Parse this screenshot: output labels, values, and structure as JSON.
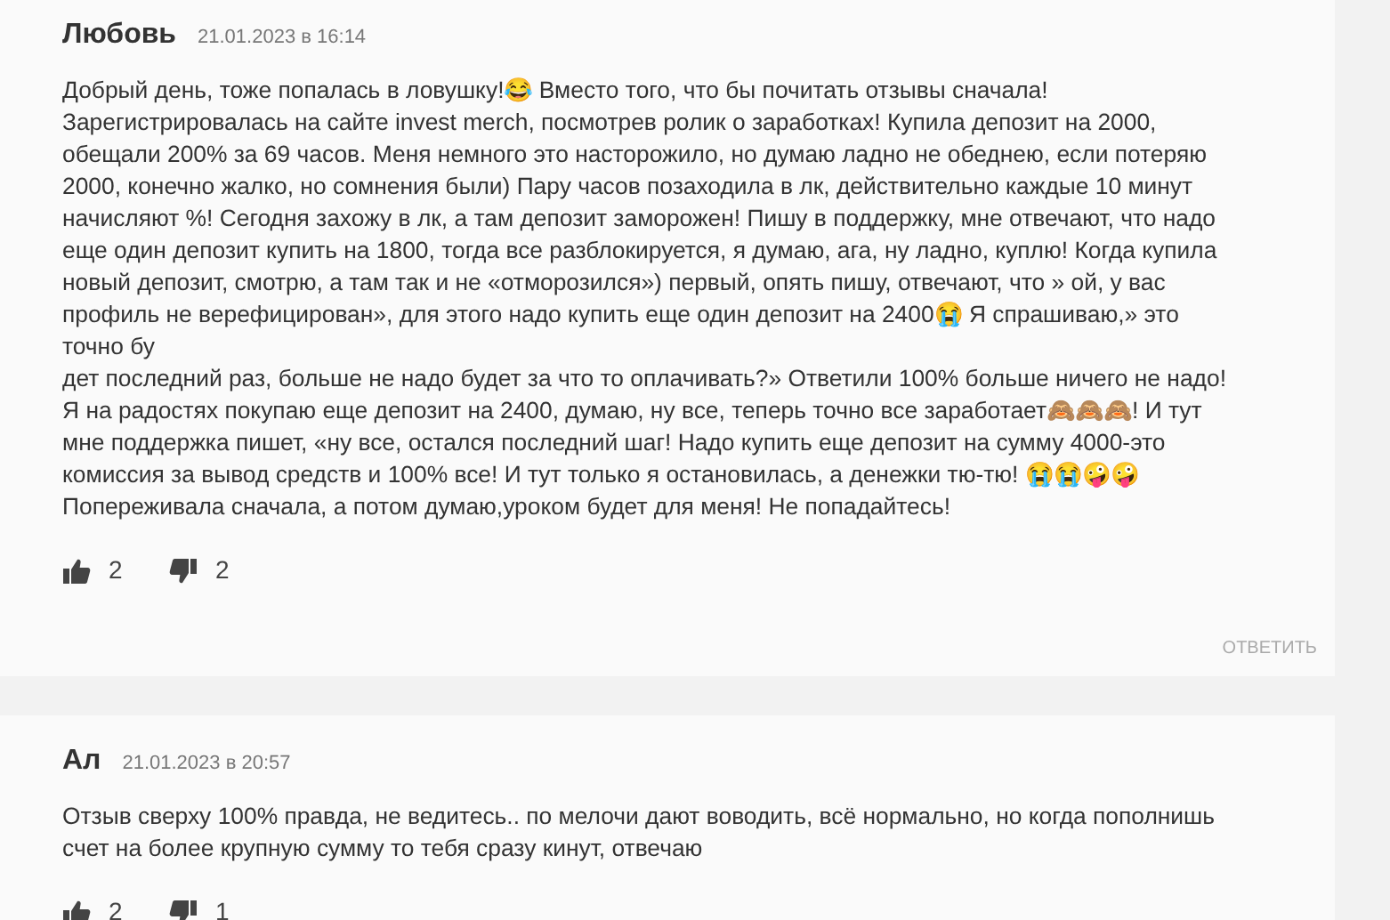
{
  "comments": [
    {
      "author": "Любовь",
      "date": "21.01.2023 в 16:14",
      "paragraphs": [
        "Добрый день, тоже попалась в ловушку!😂 Вместо того, что бы почитать отзывы сначала! Зарегистрировалась на сайте invest merch, посмотрев ролик о заработках! Купила депозит на 2000, обещали 200% за 69 часов. Меня немного это насторожило, но думаю ладно не обеднею, если потеряю 2000, конечно жалко, но сомнения были) Пару часов позаходила в лк, действительно каждые 10 минут начисляют %! Сегодня захожу в лк, а там депозит заморожен! Пишу в поддержку, мне отвечают, что надо еще один депозит купить на 1800, тогда все разблокируется, я думаю, ага, ну ладно, куплю! Когда купила новый депозит, смотрю, а там так и не «отморозился») первый, опять пишу, отвечают, что » ой, у вас профиль не верефицирован», для этого надо купить еще один депозит на 2400😭 Я спрашиваю,» это точно бу",
        "дет последний раз, больше не надо будет за что то оплачивать?» Ответили 100% больше ничего не надо! Я на радостях покупаю еще депозит на 2400, думаю, ну все, теперь точно все заработает🙈🙈🙈! И тут мне поддержка пишет, «ну все, остался последний шаг! Надо купить еще депозит на сумму 4000-это комиссия за вывод средств и 100% все! И тут только я остановилась, а денежки тю-тю! 😭😭🤪🤪 Попереживала сначала, а потом думаю,уроком будет для меня! Не попадайтесь!"
      ],
      "likes": "2",
      "dislikes": "2",
      "reply": "ОТВЕТИТЬ"
    },
    {
      "author": "Ал",
      "date": "21.01.2023 в 20:57",
      "paragraphs": [
        "Отзыв сверху 100% правда, не ведитесь.. по мелочи дают воводить, всё нормально, но когда пополнишь счет на более крупную сумму то тебя сразу кинут, отвечаю"
      ],
      "likes": "2",
      "dislikes": "1"
    }
  ]
}
